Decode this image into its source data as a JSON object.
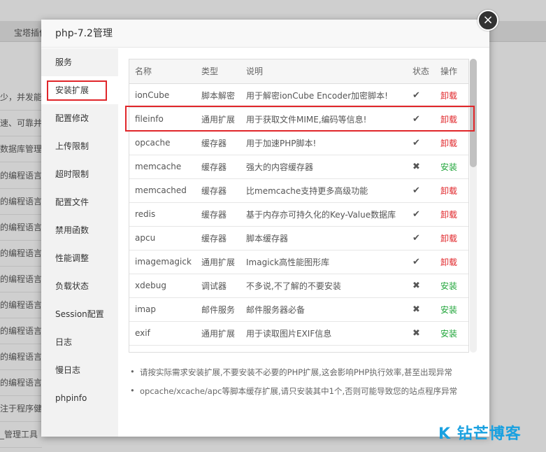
{
  "background": {
    "topbar_label": "宝塔插件",
    "rows": [
      "少，并发能",
      "速、可靠并且",
      "数据库管理",
      "的编程语言",
      "的编程语言",
      "的编程语言",
      "的编程语言",
      "的编程语言",
      "的编程语言",
      "的编程语言",
      "的编程语言",
      "的编程语言",
      "注于程序健",
      "_管理工具"
    ]
  },
  "dialog": {
    "title": "php-7.2管理",
    "close_icon": "×"
  },
  "sidebar": {
    "items": [
      "服务",
      "安装扩展",
      "配置修改",
      "上传限制",
      "超时限制",
      "配置文件",
      "禁用函数",
      "性能调整",
      "负载状态",
      "Session配置",
      "日志",
      "慢日志",
      "phpinfo"
    ],
    "active_index": 1
  },
  "table": {
    "headers": [
      "名称",
      "类型",
      "说明",
      "状态",
      "操作"
    ],
    "rows": [
      {
        "name": "ionCube",
        "type": "脚本解密",
        "desc": "用于解密ionCube Encoder加密脚本!",
        "status": "✔",
        "op": "卸载"
      },
      {
        "name": "fileinfo",
        "type": "通用扩展",
        "desc": "用于获取文件MIME,编码等信息!",
        "status": "✔",
        "op": "卸载"
      },
      {
        "name": "opcache",
        "type": "缓存器",
        "desc": "用于加速PHP脚本!",
        "status": "✔",
        "op": "卸载"
      },
      {
        "name": "memcache",
        "type": "缓存器",
        "desc": "强大的内容缓存器",
        "status": "✖",
        "op": "安装"
      },
      {
        "name": "memcached",
        "type": "缓存器",
        "desc": "比memcache支持更多高级功能",
        "status": "✔",
        "op": "卸载"
      },
      {
        "name": "redis",
        "type": "缓存器",
        "desc": "基于内存亦可持久化的Key-Value数据库",
        "status": "✔",
        "op": "卸载"
      },
      {
        "name": "apcu",
        "type": "缓存器",
        "desc": "脚本缓存器",
        "status": "✔",
        "op": "卸载"
      },
      {
        "name": "imagemagick",
        "type": "通用扩展",
        "desc": "Imagick高性能图形库",
        "status": "✔",
        "op": "卸载"
      },
      {
        "name": "xdebug",
        "type": "调试器",
        "desc": "不多说,不了解的不要安装",
        "status": "✖",
        "op": "安装"
      },
      {
        "name": "imap",
        "type": "邮件服务",
        "desc": "邮件服务器必备",
        "status": "✖",
        "op": "安装"
      },
      {
        "name": "exif",
        "type": "通用扩展",
        "desc": "用于读取图片EXIF信息",
        "status": "✖",
        "op": "安装"
      }
    ]
  },
  "notes": [
    "请按实际需求安装扩展,不要安装不必要的PHP扩展,这会影响PHP执行效率,甚至出现异常",
    "opcache/xcache/apc等脚本缓存扩展,请只安装其中1个,否则可能导致您的站点程序异常"
  ],
  "watermark": "K 钻芒博客",
  "colors": {
    "uninstall": "#e0262a",
    "install": "#20a53a",
    "highlight": "#e0262a"
  }
}
